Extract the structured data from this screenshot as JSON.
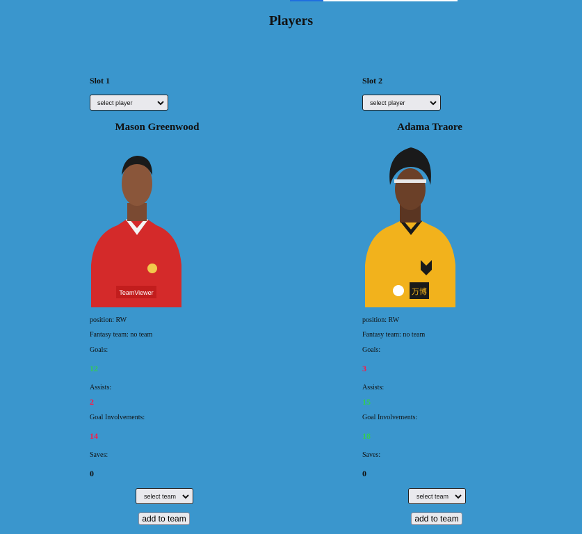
{
  "page": {
    "title": "Players"
  },
  "labels": {
    "select_player": "select player",
    "position_prefix": "position: ",
    "fantasy_prefix": "Fantasy team: ",
    "goals": "Goals:",
    "assists": "Assists:",
    "goal_involvements": "Goal Involvements:",
    "saves": "Saves:",
    "select_team": "select team",
    "add_to_team": "add to team"
  },
  "colors": {
    "background": "#3a96cd",
    "good": "#33cc55",
    "bad": "#ff1744",
    "neutral": "#111111"
  },
  "slots": [
    {
      "label": "Slot 1",
      "player_name": "Mason Greenwood",
      "position": "position: RW",
      "fantasy_team": "Fantasy team: no team",
      "goals": "12",
      "assists": "2",
      "goal_involvements": "14",
      "saves": "0",
      "kit": "red"
    },
    {
      "label": "Slot 2",
      "player_name": "Adama Traore",
      "position": "position: RW",
      "fantasy_team": "Fantasy team: no team",
      "goals": "3",
      "assists": "15",
      "goal_involvements": "18",
      "saves": "0",
      "kit": "gold"
    }
  ]
}
